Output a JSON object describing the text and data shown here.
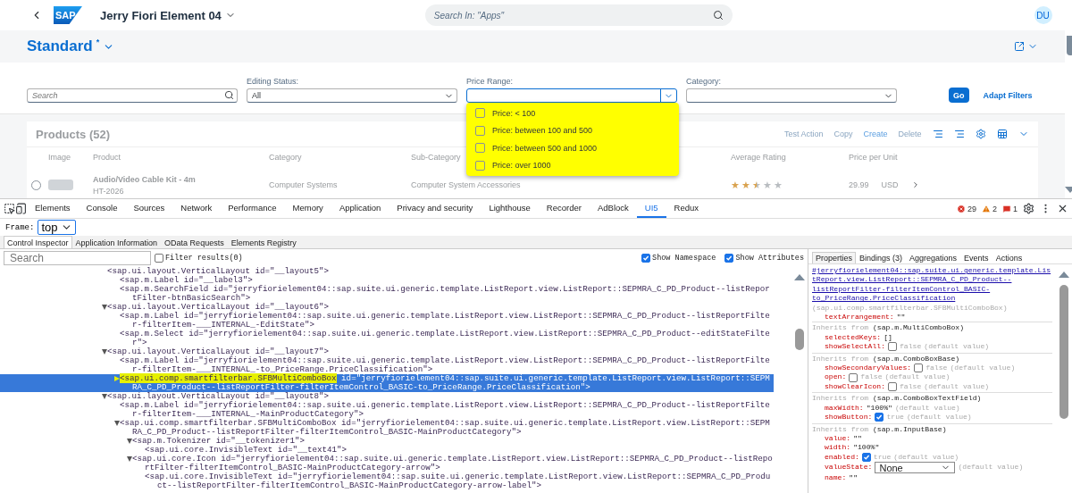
{
  "shell": {
    "logo": "SAP",
    "title": "Jerry Fiori Element 04",
    "search_placeholder": "Search In: \"Apps\"",
    "avatar": "DU"
  },
  "page_header": {
    "variant": "Standard",
    "dirty_mark": "*"
  },
  "filter_bar": {
    "search_placeholder": "Search",
    "filters": [
      {
        "label": "Editing Status:",
        "value": "All",
        "kind": "select"
      },
      {
        "label": "Price Range:",
        "kind": "multicombo"
      },
      {
        "label": "Category:",
        "kind": "select"
      }
    ],
    "go": "Go",
    "adapt": "Adapt Filters"
  },
  "price_popover": {
    "items": [
      {
        "label": "Price: < 100",
        "checked": false
      },
      {
        "label": "Price: between 100 and 500",
        "checked": false
      },
      {
        "label": "Price: between 500 and 1000",
        "checked": false
      },
      {
        "label": "Price: over 1000",
        "checked": false
      }
    ]
  },
  "table": {
    "title": "Products (52)",
    "actions": [
      {
        "label": "Test Action",
        "enabled": false
      },
      {
        "label": "Copy",
        "enabled": false
      },
      {
        "label": "Create",
        "enabled": true
      },
      {
        "label": "Delete",
        "enabled": false
      }
    ],
    "columns": [
      "Image",
      "Product",
      "Category",
      "Sub-Category",
      "Average Rating",
      "Price per Unit"
    ],
    "rows": [
      {
        "selected": false,
        "product": "Audio/Video Cable Kit - 4m",
        "id": "HT-2026",
        "category": "Computer Systems",
        "sub_category": "Computer System Accessories",
        "stars": 2.5,
        "price": "29.99",
        "currency": "USD"
      }
    ]
  },
  "devtools": {
    "tabs": [
      {
        "label": "Elements",
        "selected": false
      },
      {
        "label": "Console",
        "selected": false
      },
      {
        "label": "Sources",
        "selected": false
      },
      {
        "label": "Network",
        "selected": false
      },
      {
        "label": "Performance",
        "selected": false
      },
      {
        "label": "Memory",
        "selected": false
      },
      {
        "label": "Application",
        "selected": false
      },
      {
        "label": "Privacy and security",
        "selected": false
      },
      {
        "label": "Lighthouse",
        "selected": false
      },
      {
        "label": "Recorder",
        "selected": false
      },
      {
        "label": "AdBlock",
        "selected": false
      },
      {
        "label": "UI5",
        "selected": true
      },
      {
        "label": "Redux",
        "selected": false
      }
    ],
    "counts": {
      "errors": "29",
      "warnings": "2",
      "issues": "1"
    },
    "frame_label": "Frame:",
    "frame_value": "top",
    "subtabs": [
      {
        "label": "Control Inspector",
        "selected": true
      },
      {
        "label": "Application Information",
        "selected": false
      },
      {
        "label": "OData Requests",
        "selected": false
      },
      {
        "label": "Elements Registry",
        "selected": false
      }
    ],
    "search_placeholder": "Search",
    "filter_results": {
      "label": "Filter results(0)",
      "checked": false
    },
    "show_namespace": {
      "label": "Show Namespace",
      "checked": true
    },
    "show_attributes": {
      "label": "Show Attributes",
      "checked": true
    },
    "tree": [
      {
        "tag": "<sap.ui.layout.VerticalLayout",
        "attrs": " id=\"__layout5\">",
        "selected": false,
        "marked": false,
        "children": [
          {
            "tag": "<sap.m.Label",
            "attrs": " id=\"__label3\">",
            "selected": false,
            "marked": false
          },
          {
            "tag": "<sap.m.SearchField",
            "attrs": " id=\"jerryfiorielement04::sap.suite.ui.generic.template.ListReport.view.ListReport::SEPMRA_C_PD_Product--listReportFilter-btnBasicSearch\">",
            "selected": false,
            "marked": false
          }
        ]
      },
      {
        "tag": "<sap.ui.layout.VerticalLayout",
        "attrs": " id=\"__layout6\">",
        "expanded": true,
        "selected": false,
        "marked": false,
        "children": [
          {
            "tag": "<sap.m.Label",
            "attrs": " id=\"jerryfiorielement04::sap.suite.ui.generic.template.ListReport.view.ListReport::SEPMRA_C_PD_Product--listReportFilter-filterItem-___INTERNAL_-EditState\">",
            "selected": false,
            "marked": false
          },
          {
            "tag": "<sap.m.Select",
            "attrs": " id=\"jerryfiorielement04::sap.suite.ui.generic.template.ListReport.view.ListReport::SEPMRA_C_PD_Product--editStateFilter\">",
            "selected": false,
            "marked": false
          }
        ]
      },
      {
        "tag": "<sap.ui.layout.VerticalLayout",
        "attrs": " id=\"__layout7\">",
        "expanded": true,
        "selected": false,
        "marked": false,
        "children": [
          {
            "tag": "<sap.m.Label",
            "attrs": " id=\"jerryfiorielement04::sap.suite.ui.generic.template.ListReport.view.ListReport::SEPMRA_C_PD_Product--listReportFilter-filterItem-___INTERNAL_-to_PriceRange.PriceClassification\">",
            "selected": false,
            "marked": false
          },
          {
            "tag": "<sap.ui.comp.smartfilterbar.SFBMultiComboBox",
            "attrs": " id=\"jerryfiorielement04::sap.suite.ui.generic.template.ListReport.view.ListReport::SEPMRA_C_PD_Product--listReportFilter-filterItemControl_BASIC-to_PriceRange.PriceClassification\">",
            "expanded": false,
            "selected": true,
            "marked": true
          }
        ]
      },
      {
        "tag": "<sap.ui.layout.VerticalLayout",
        "attrs": " id=\"__layout8\">",
        "expanded": true,
        "selected": false,
        "marked": false,
        "children": [
          {
            "tag": "<sap.m.Label",
            "attrs": " id=\"jerryfiorielement04::sap.suite.ui.generic.template.ListReport.view.ListReport::SEPMRA_C_PD_Product--listReportFilter-filterItem-___INTERNAL_-MainProductCategory\">",
            "selected": false,
            "marked": false
          },
          {
            "tag": "<sap.ui.comp.smartfilterbar.SFBMultiComboBox",
            "attrs": " id=\"jerryfiorielement04::sap.suite.ui.generic.template.ListReport.view.ListReport::SEPMRA_C_PD_Product--listReportFilter-filterItemControl_BASIC-MainProductCategory\">",
            "expanded": true,
            "selected": false,
            "marked": false,
            "children": [
              {
                "tag": "<sap.m.Tokenizer",
                "attrs": " id=\"__tokenizer1\">",
                "expanded": true,
                "selected": false,
                "marked": false,
                "children": [
                  {
                    "tag": "<sap.ui.core.InvisibleText",
                    "attrs": " id=\"__text41\">",
                    "selected": false,
                    "marked": false
                  }
                ]
              },
              {
                "tag": "<sap.ui.core.Icon",
                "attrs": " id=\"jerryfiorielement04::sap.suite.ui.generic.template.ListReport.view.ListReport::SEPMRA_C_PD_Product--listReportFilter-filterItemControl_BASIC-MainProductCategory-arrow\">",
                "expanded": true,
                "selected": false,
                "marked": false,
                "children": [
                  {
                    "tag": "<sap.ui.core.InvisibleText",
                    "attrs": " id=\"jerryfiorielement04::sap.suite.ui.generic.template.ListReport.view.ListReport::SEPMRA_C_PD_Product--listReportFilter-filterItemControl_BASIC-MainProductCategory-arrow-label\">",
                    "selected": false,
                    "marked": false
                  }
                ]
              }
            ]
          }
        ]
      }
    ],
    "side_tabs": [
      {
        "label": "Properties",
        "selected": true
      },
      {
        "label": "Bindings (3)",
        "selected": false
      },
      {
        "label": "Aggregations",
        "selected": false
      },
      {
        "label": "Events",
        "selected": false
      },
      {
        "label": "Actions",
        "selected": false
      }
    ],
    "control_link": "#jerryfiorielement04::sap.suite.ui.generic.template.ListReport.view.ListReport::SEPMRA_C_PD_Product--listReportFilter-filterItemControl_BASIC-to_PriceRange.PriceClassification",
    "control_type": "(sap.ui.comp.smartfilterbar.SFBMultiComboBox)",
    "own_props": [
      {
        "name": "textArrangement:",
        "kind": "text",
        "value": "\"\""
      }
    ],
    "sections": [
      {
        "inherits": "Inherits from",
        "class": "(sap.m.MultiComboBox)",
        "props": [
          {
            "name": "selectedKeys:",
            "kind": "text",
            "value": "[]"
          },
          {
            "name": "showSelectAll:",
            "kind": "checkbox",
            "checked": false,
            "value": "false",
            "note": "(default value)"
          }
        ]
      },
      {
        "inherits": "Inherits from",
        "class": "(sap.m.ComboBoxBase)",
        "props": [
          {
            "name": "showSecondaryValues:",
            "kind": "checkbox",
            "checked": false,
            "value": "false",
            "note": "(default value)"
          },
          {
            "name": "open:",
            "kind": "checkbox",
            "checked": false,
            "value": "false",
            "note": "(default value)"
          },
          {
            "name": "showClearIcon:",
            "kind": "checkbox",
            "checked": false,
            "value": "false",
            "note": "(default value)"
          }
        ]
      },
      {
        "inherits": "Inherits from",
        "class": "(sap.m.ComboBoxTextField)",
        "props": [
          {
            "name": "maxWidth:",
            "kind": "text",
            "value": "\"100%\"",
            "note": "(default value)"
          },
          {
            "name": "showButton:",
            "kind": "checkbox",
            "checked": true,
            "value": "true",
            "note": "(default value)"
          }
        ]
      },
      {
        "inherits": "Inherits from",
        "class": "(sap.m.InputBase)",
        "props": [
          {
            "name": "value:",
            "kind": "text",
            "value": "\"\""
          },
          {
            "name": "width:",
            "kind": "text",
            "value": "\"100%\""
          },
          {
            "name": "enabled:",
            "kind": "checkbox",
            "checked": true,
            "value": "true",
            "note": "(default value)"
          },
          {
            "name": "valueState:",
            "kind": "select",
            "value": "None",
            "note": "(default value)"
          },
          {
            "name": "name:",
            "kind": "text",
            "value": "\"\""
          }
        ]
      }
    ]
  }
}
